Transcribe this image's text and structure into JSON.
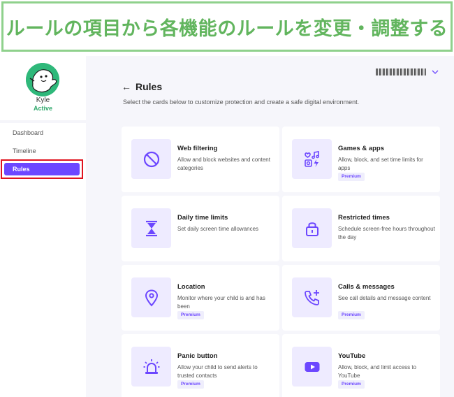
{
  "banner": {
    "text": "ルールの項目から各機能のルールを変更・調整する"
  },
  "sidebar": {
    "profile": {
      "name": "Kyle",
      "status": "Active"
    },
    "nav": [
      {
        "label": "Dashboard"
      },
      {
        "label": "Timeline"
      },
      {
        "label": "Rules",
        "active": true
      }
    ]
  },
  "header": {
    "back_icon": "←",
    "title": "Rules",
    "subtitle": "Select the cards below to customize protection and create a safe digital environment."
  },
  "accent_color": "#6c47ff",
  "cards": [
    {
      "title": "Web filtering",
      "desc": "Allow and block websites and content categories",
      "badge": "",
      "icon": "block-icon"
    },
    {
      "title": "Games & apps",
      "desc": "Allow, block, and set time limits for apps",
      "badge": "Premium",
      "icon": "apps-icon"
    },
    {
      "title": "Daily time limits",
      "desc": "Set daily screen time allowances",
      "badge": "",
      "icon": "hourglass-icon"
    },
    {
      "title": "Restricted times",
      "desc": "Schedule screen-free hours throughout the day",
      "badge": "",
      "icon": "lock-icon"
    },
    {
      "title": "Location",
      "desc": "Monitor where your child is and has been",
      "badge": "Premium",
      "icon": "location-pin-icon"
    },
    {
      "title": "Calls & messages",
      "desc": "See call details and message content",
      "badge": "Premium",
      "icon": "phone-plus-icon"
    },
    {
      "title": "Panic button",
      "desc": "Allow your child to send alerts to trusted contacts",
      "badge": "Premium",
      "icon": "siren-icon"
    },
    {
      "title": "YouTube",
      "desc": "Allow, block, and limit access to YouTube",
      "badge": "Premium",
      "icon": "youtube-play-icon"
    }
  ]
}
